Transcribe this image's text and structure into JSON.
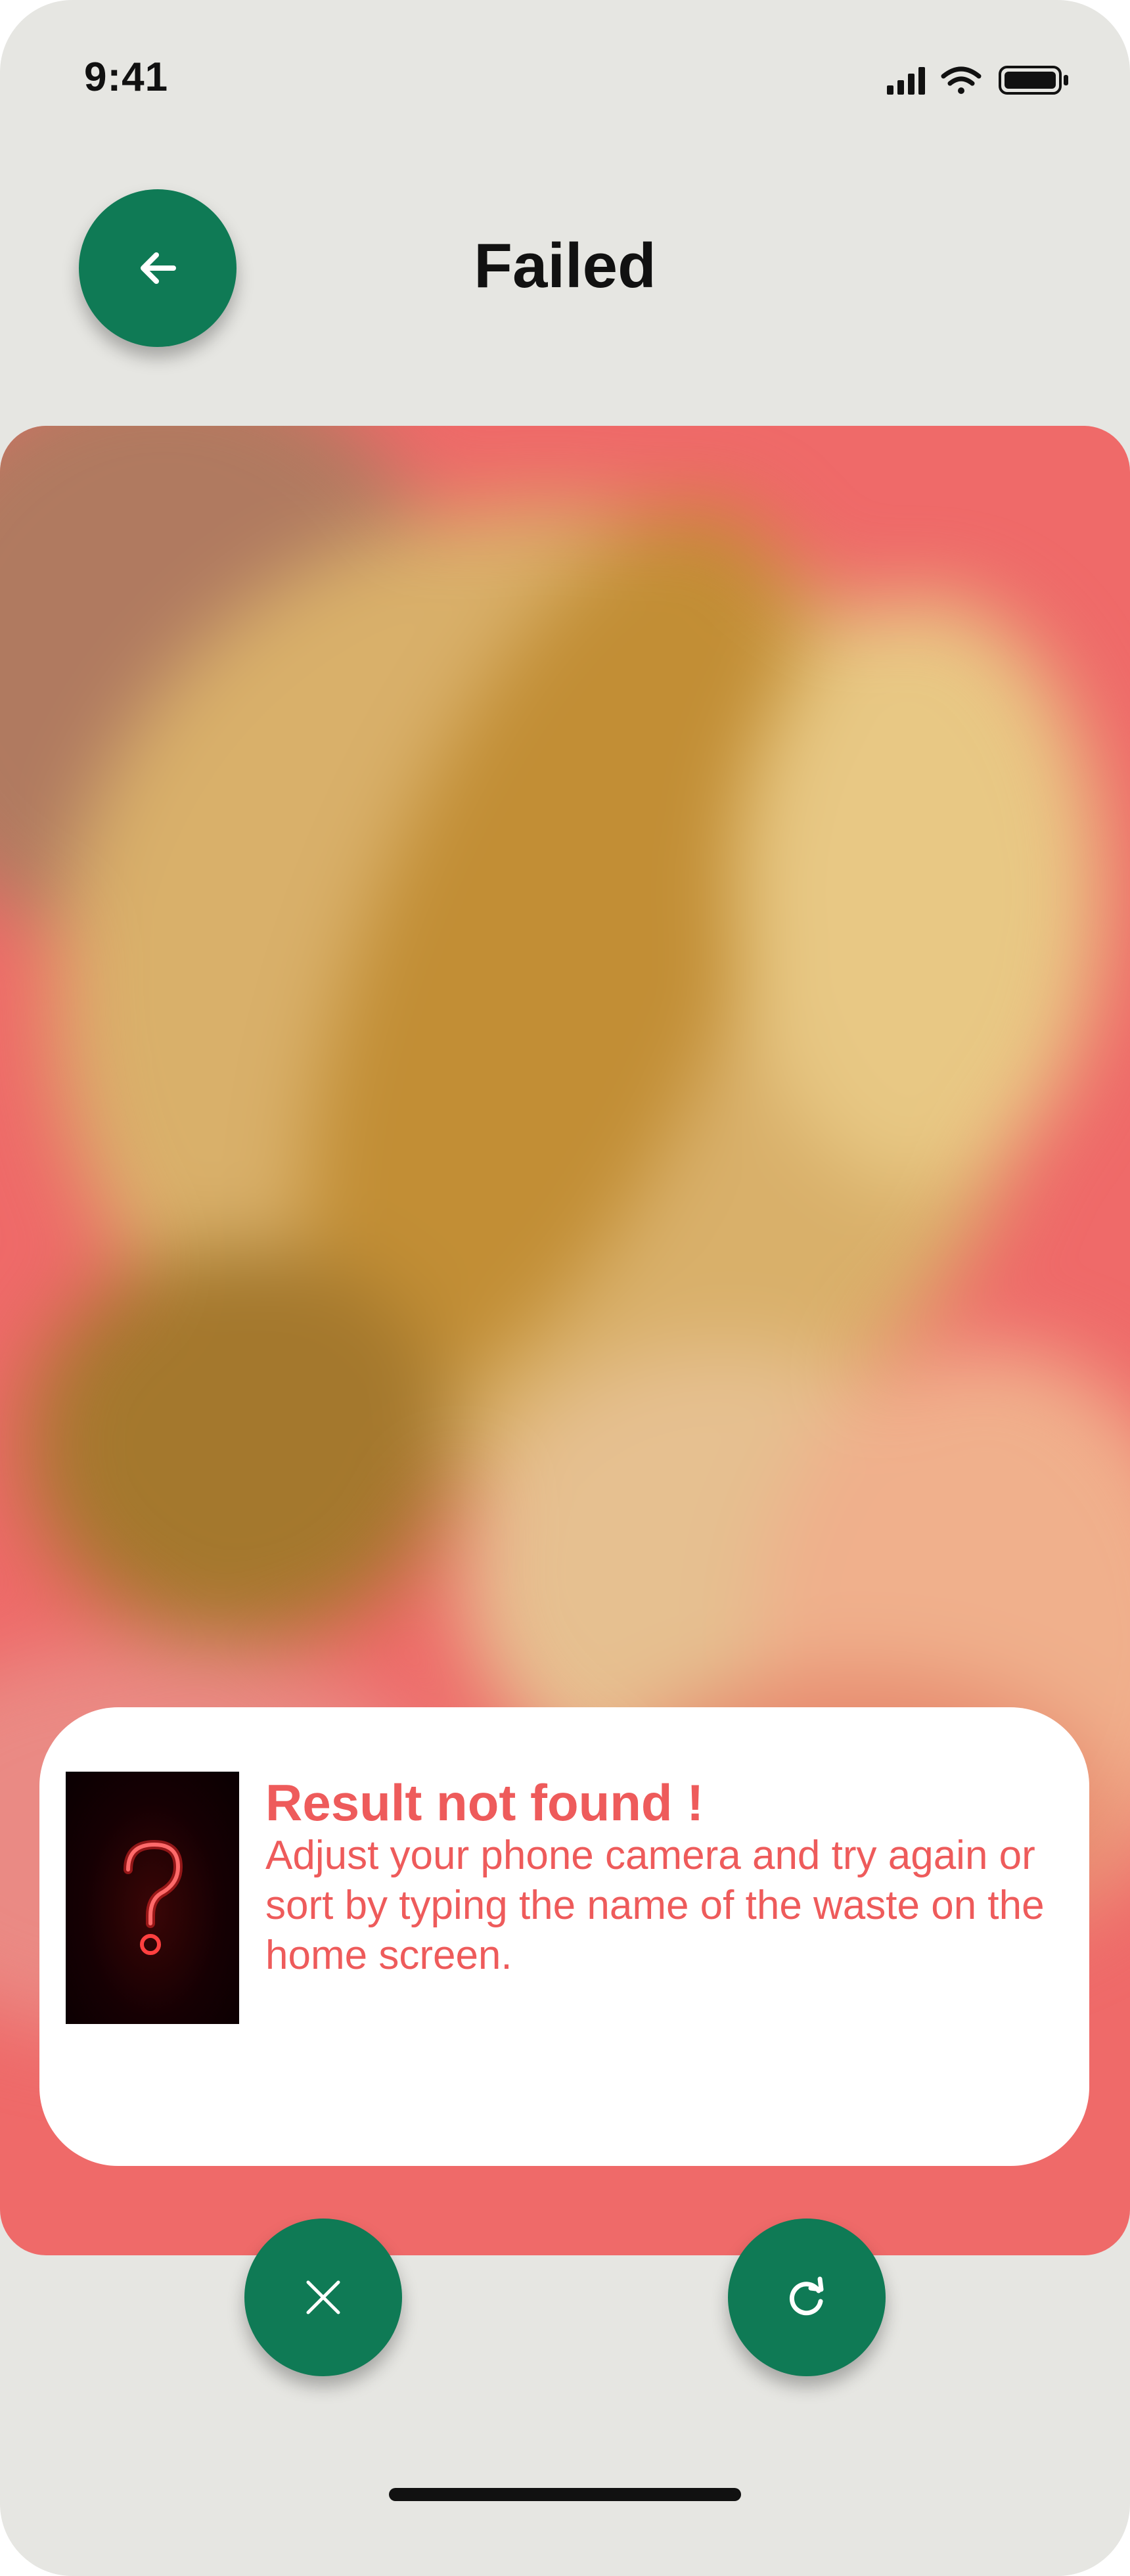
{
  "status_bar": {
    "time": "9:41",
    "icons": [
      "signal-icon",
      "wifi-icon",
      "battery-icon"
    ]
  },
  "header": {
    "title": "Failed",
    "back_icon": "arrow-left-icon"
  },
  "result": {
    "title": "Result not found !",
    "description": "Adjust your phone camera and try again or sort by typing the name of the waste on the home screen.",
    "thumbnail_icon": "question-mark-icon"
  },
  "actions": {
    "cancel_icon": "close-icon",
    "retry_icon": "refresh-icon"
  },
  "colors": {
    "accent": "#0f7a55",
    "error": "#ee5b5b",
    "preview_background": "#ef6a69"
  }
}
